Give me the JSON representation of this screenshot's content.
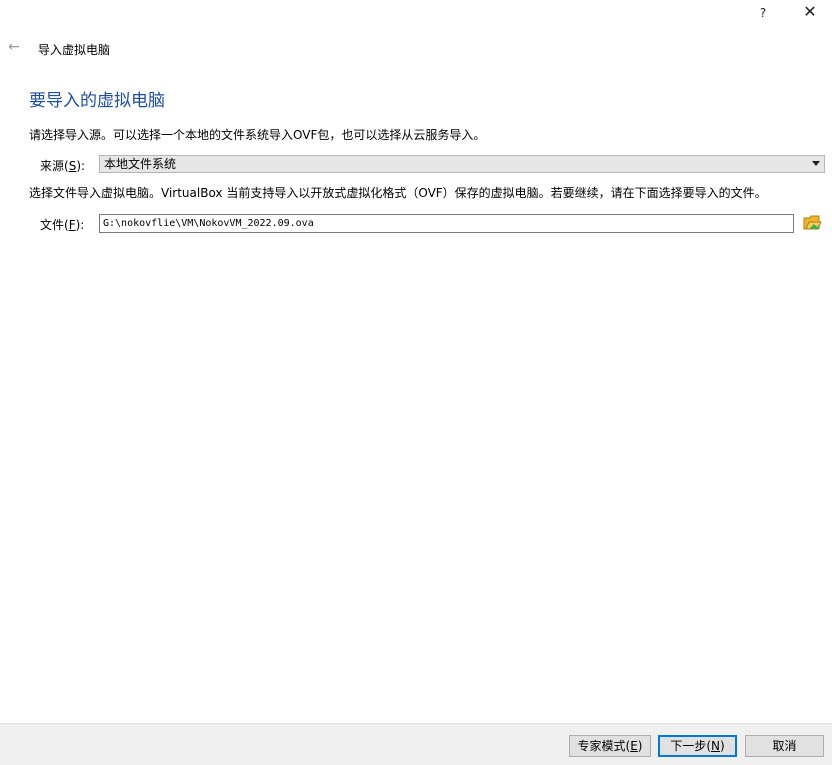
{
  "titlebar": {
    "help_label": "?",
    "close_label": "✕"
  },
  "wizard": {
    "back_label": "←",
    "title": "导入虚拟电脑"
  },
  "page": {
    "heading": "要导入的虚拟电脑",
    "intro": "请选择导入源。可以选择一个本地的文件系统导入OVF包，也可以选择从云服务导入。",
    "source_label_prefix": "来源(",
    "source_label_key": "S",
    "source_label_suffix": "):",
    "source_value": "本地文件系统",
    "description": "选择文件导入虚拟电脑。VirtualBox 当前支持导入以开放式虚拟化格式（OVF）保存的虚拟电脑。若要继续，请在下面选择要导入的文件。",
    "file_label_prefix": "文件(",
    "file_label_key": "F",
    "file_label_suffix": "):",
    "file_value": "G:\\nokovflie\\VM\\NokovVM_2022.09.ova"
  },
  "footer": {
    "expert_prefix": "专家模式(",
    "expert_key": "E",
    "expert_suffix": ")",
    "next_prefix": "下一步(",
    "next_key": "N",
    "next_suffix": ")",
    "cancel_label": "取消"
  },
  "icons": {
    "folder": "folder-open-icon",
    "folder_color": "#f2b52e",
    "folder_accent": "#3fae49"
  },
  "colors": {
    "heading": "#1f4e9c",
    "default_button_border": "#0078d7"
  }
}
